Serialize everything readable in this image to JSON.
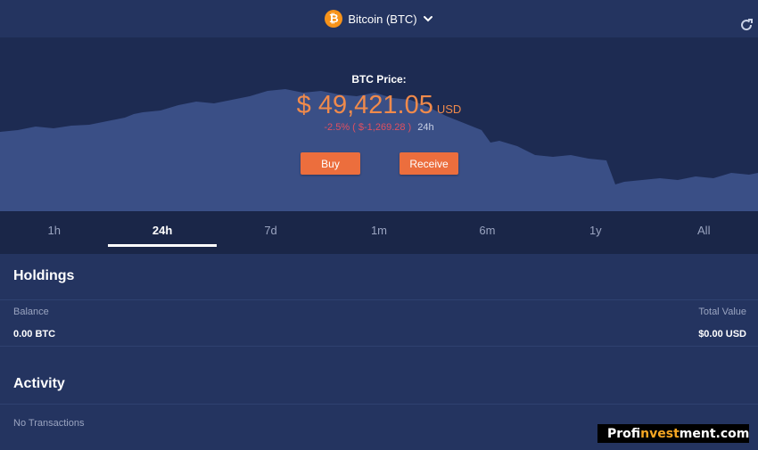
{
  "header": {
    "asset_label": "Bitcoin (BTC)",
    "asset_icon": "bitcoin-icon",
    "btc_glyph": "₿"
  },
  "price": {
    "label": "BTC Price:",
    "value": "$ 49,421.05",
    "currency": "USD",
    "change_pct": "-2.5%",
    "change_abs": "( $-1,269.28 )",
    "change_period": "24h"
  },
  "actions": {
    "buy_label": "Buy",
    "receive_label": "Receive"
  },
  "timeframes": [
    {
      "label": "1h",
      "active": false
    },
    {
      "label": "24h",
      "active": true
    },
    {
      "label": "7d",
      "active": false
    },
    {
      "label": "1m",
      "active": false
    },
    {
      "label": "6m",
      "active": false
    },
    {
      "label": "1y",
      "active": false
    },
    {
      "label": "All",
      "active": false
    }
  ],
  "holdings": {
    "title": "Holdings",
    "balance_label": "Balance",
    "balance_value": "0.00 BTC",
    "total_label": "Total Value",
    "total_value": "$0.00 USD"
  },
  "activity": {
    "title": "Activity",
    "empty_text": "No Transactions"
  },
  "watermark": {
    "prefix": "Prof",
    "accent": "invest",
    "suffix": "ment.com"
  },
  "colors": {
    "accent": "#ec6e3d",
    "price": "#f08a4b",
    "negative": "#e05060",
    "bitcoin": "#f7931a",
    "background": "#243460",
    "chart_fill": "#3a4f86"
  }
}
